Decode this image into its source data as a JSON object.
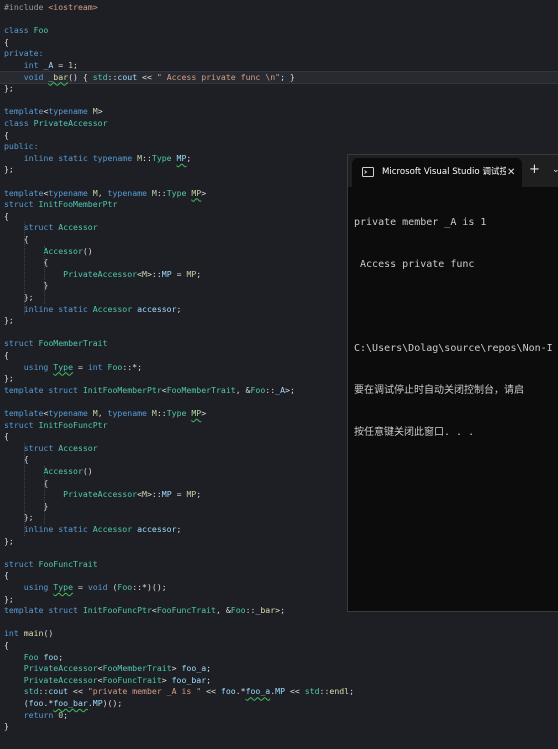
{
  "colors": {
    "editor_bg": "#1e1f24",
    "keyword": "#569cd6",
    "type": "#4ec9b0",
    "identifier": "#9cdcfe",
    "string": "#d69d85",
    "number": "#b5cea8",
    "preprocessor": "#9b9b9b",
    "template_param": "#b8d7a3",
    "plain": "#dcdcdc",
    "console_bg": "#0c0c0c",
    "console_text": "#cccccc"
  },
  "editor": {
    "lines": [
      [
        {
          "t": "#include ",
          "c": "pre"
        },
        {
          "t": "<iostream>",
          "c": "str"
        }
      ],
      [],
      [
        {
          "t": "class ",
          "c": "kw"
        },
        {
          "t": "Foo",
          "c": "ty"
        }
      ],
      [
        {
          "t": "{",
          "c": "pl"
        }
      ],
      [
        {
          "t": "private:",
          "c": "kw"
        }
      ],
      [
        {
          "t": "    ",
          "c": "pl"
        },
        {
          "t": "int ",
          "c": "kw"
        },
        {
          "t": "_A",
          "c": "id",
          "sq": true
        },
        {
          "t": " = ",
          "c": "pl"
        },
        {
          "t": "1",
          "c": "num"
        },
        {
          "t": ";",
          "c": "pl"
        }
      ],
      [
        {
          "t": "    ",
          "c": "pl"
        },
        {
          "t": "void ",
          "c": "kw"
        },
        {
          "t": "_bar",
          "c": "fn",
          "sq": true
        },
        {
          "t": "() { ",
          "c": "pl"
        },
        {
          "t": "std",
          "c": "ty"
        },
        {
          "t": "::",
          "c": "pl"
        },
        {
          "t": "cout",
          "c": "id"
        },
        {
          "t": " << ",
          "c": "pl"
        },
        {
          "t": "\" Access private func \\n\"",
          "c": "str"
        },
        {
          "t": "; }",
          "c": "pl"
        }
      ],
      [
        {
          "t": "};",
          "c": "pl"
        }
      ],
      [],
      [
        {
          "t": "template",
          "c": "kw"
        },
        {
          "t": "<",
          "c": "pl"
        },
        {
          "t": "typename ",
          "c": "kw"
        },
        {
          "t": "M",
          "c": "tp"
        },
        {
          "t": ">",
          "c": "pl"
        }
      ],
      [
        {
          "t": "class ",
          "c": "kw"
        },
        {
          "t": "PrivateAccessor",
          "c": "ty"
        }
      ],
      [
        {
          "t": "{",
          "c": "pl"
        }
      ],
      [
        {
          "t": "public:",
          "c": "kw"
        }
      ],
      [
        {
          "t": "    ",
          "c": "pl"
        },
        {
          "t": "inline static typename ",
          "c": "kw"
        },
        {
          "t": "M",
          "c": "tp"
        },
        {
          "t": "::",
          "c": "pl"
        },
        {
          "t": "Type ",
          "c": "ty"
        },
        {
          "t": "MP",
          "c": "id",
          "sq": true
        },
        {
          "t": ";",
          "c": "pl"
        }
      ],
      [
        {
          "t": "};",
          "c": "pl"
        }
      ],
      [],
      [
        {
          "t": "template",
          "c": "kw"
        },
        {
          "t": "<",
          "c": "pl"
        },
        {
          "t": "typename ",
          "c": "kw"
        },
        {
          "t": "M",
          "c": "tp"
        },
        {
          "t": ", ",
          "c": "pl"
        },
        {
          "t": "typename ",
          "c": "kw"
        },
        {
          "t": "M",
          "c": "tp"
        },
        {
          "t": "::",
          "c": "pl"
        },
        {
          "t": "Type ",
          "c": "ty"
        },
        {
          "t": "MP",
          "c": "tp",
          "sq": true
        },
        {
          "t": ">",
          "c": "pl"
        }
      ],
      [
        {
          "t": "struct ",
          "c": "kw"
        },
        {
          "t": "InitFooMemberPtr",
          "c": "ty"
        }
      ],
      [
        {
          "t": "{",
          "c": "pl"
        }
      ],
      [
        {
          "t": "    ",
          "c": "pl"
        },
        {
          "t": "struct ",
          "c": "kw"
        },
        {
          "t": "Accessor",
          "c": "ty"
        }
      ],
      [
        {
          "t": "    {",
          "c": "pl"
        }
      ],
      [
        {
          "t": "        ",
          "c": "pl"
        },
        {
          "t": "Accessor",
          "c": "ty"
        },
        {
          "t": "()",
          "c": "pl"
        }
      ],
      [
        {
          "t": "        {",
          "c": "pl"
        }
      ],
      [
        {
          "t": "            ",
          "c": "pl"
        },
        {
          "t": "PrivateAccessor",
          "c": "ty"
        },
        {
          "t": "<",
          "c": "pl"
        },
        {
          "t": "M",
          "c": "tp"
        },
        {
          "t": ">::",
          "c": "pl"
        },
        {
          "t": "MP",
          "c": "id"
        },
        {
          "t": " = ",
          "c": "pl"
        },
        {
          "t": "MP",
          "c": "tp"
        },
        {
          "t": ";",
          "c": "pl"
        }
      ],
      [
        {
          "t": "        }",
          "c": "pl"
        }
      ],
      [
        {
          "t": "    };",
          "c": "pl"
        }
      ],
      [
        {
          "t": "    ",
          "c": "pl"
        },
        {
          "t": "inline static ",
          "c": "kw"
        },
        {
          "t": "Accessor ",
          "c": "ty"
        },
        {
          "t": "accessor",
          "c": "id"
        },
        {
          "t": ";",
          "c": "pl"
        }
      ],
      [
        {
          "t": "};",
          "c": "pl"
        }
      ],
      [],
      [
        {
          "t": "struct ",
          "c": "kw"
        },
        {
          "t": "FooMemberTrait",
          "c": "ty"
        }
      ],
      [
        {
          "t": "{",
          "c": "pl"
        }
      ],
      [
        {
          "t": "    ",
          "c": "pl"
        },
        {
          "t": "using ",
          "c": "kw"
        },
        {
          "t": "Type",
          "c": "ty",
          "sq": true
        },
        {
          "t": " = ",
          "c": "pl"
        },
        {
          "t": "int ",
          "c": "kw"
        },
        {
          "t": "Foo",
          "c": "ty"
        },
        {
          "t": "::*;",
          "c": "pl"
        }
      ],
      [
        {
          "t": "};",
          "c": "pl"
        }
      ],
      [
        {
          "t": "template struct ",
          "c": "kw"
        },
        {
          "t": "InitFooMemberPtr",
          "c": "ty"
        },
        {
          "t": "<",
          "c": "pl"
        },
        {
          "t": "FooMemberTrait",
          "c": "ty"
        },
        {
          "t": ", &",
          "c": "pl"
        },
        {
          "t": "Foo",
          "c": "ty"
        },
        {
          "t": "::",
          "c": "pl"
        },
        {
          "t": "_A",
          "c": "id"
        },
        {
          "t": ">;",
          "c": "pl"
        }
      ],
      [],
      [
        {
          "t": "template",
          "c": "kw"
        },
        {
          "t": "<",
          "c": "pl"
        },
        {
          "t": "typename ",
          "c": "kw"
        },
        {
          "t": "M",
          "c": "tp"
        },
        {
          "t": ", ",
          "c": "pl"
        },
        {
          "t": "typename ",
          "c": "kw"
        },
        {
          "t": "M",
          "c": "tp"
        },
        {
          "t": "::",
          "c": "pl"
        },
        {
          "t": "Type ",
          "c": "ty"
        },
        {
          "t": "MP",
          "c": "tp",
          "sq": true
        },
        {
          "t": ">",
          "c": "pl"
        }
      ],
      [
        {
          "t": "struct ",
          "c": "kw"
        },
        {
          "t": "InitFooFuncPtr",
          "c": "ty"
        }
      ],
      [
        {
          "t": "{",
          "c": "pl"
        }
      ],
      [
        {
          "t": "    ",
          "c": "pl"
        },
        {
          "t": "struct ",
          "c": "kw"
        },
        {
          "t": "Accessor",
          "c": "ty"
        }
      ],
      [
        {
          "t": "    {",
          "c": "pl"
        }
      ],
      [
        {
          "t": "        ",
          "c": "pl"
        },
        {
          "t": "Accessor",
          "c": "ty"
        },
        {
          "t": "()",
          "c": "pl"
        }
      ],
      [
        {
          "t": "        {",
          "c": "pl"
        }
      ],
      [
        {
          "t": "            ",
          "c": "pl"
        },
        {
          "t": "PrivateAccessor",
          "c": "ty"
        },
        {
          "t": "<",
          "c": "pl"
        },
        {
          "t": "M",
          "c": "tp"
        },
        {
          "t": ">::",
          "c": "pl"
        },
        {
          "t": "MP",
          "c": "id"
        },
        {
          "t": " = ",
          "c": "pl"
        },
        {
          "t": "MP",
          "c": "tp"
        },
        {
          "t": ";",
          "c": "pl"
        }
      ],
      [
        {
          "t": "        }",
          "c": "pl"
        }
      ],
      [
        {
          "t": "    };",
          "c": "pl"
        }
      ],
      [
        {
          "t": "    ",
          "c": "pl"
        },
        {
          "t": "inline static ",
          "c": "kw"
        },
        {
          "t": "Accessor ",
          "c": "ty"
        },
        {
          "t": "accessor",
          "c": "id"
        },
        {
          "t": ";",
          "c": "pl"
        }
      ],
      [
        {
          "t": "};",
          "c": "pl"
        }
      ],
      [],
      [
        {
          "t": "struct ",
          "c": "kw"
        },
        {
          "t": "FooFuncTrait",
          "c": "ty"
        }
      ],
      [
        {
          "t": "{",
          "c": "pl"
        }
      ],
      [
        {
          "t": "    ",
          "c": "pl"
        },
        {
          "t": "using ",
          "c": "kw"
        },
        {
          "t": "Type",
          "c": "ty",
          "sq": true
        },
        {
          "t": " = ",
          "c": "pl"
        },
        {
          "t": "void ",
          "c": "kw"
        },
        {
          "t": "(",
          "c": "pl"
        },
        {
          "t": "Foo",
          "c": "ty"
        },
        {
          "t": "::*)();",
          "c": "pl"
        }
      ],
      [
        {
          "t": "};",
          "c": "pl"
        }
      ],
      [
        {
          "t": "template struct ",
          "c": "kw"
        },
        {
          "t": "InitFooFuncPtr",
          "c": "ty"
        },
        {
          "t": "<",
          "c": "pl"
        },
        {
          "t": "FooFuncTrait",
          "c": "ty"
        },
        {
          "t": ", &",
          "c": "pl"
        },
        {
          "t": "Foo",
          "c": "ty"
        },
        {
          "t": "::",
          "c": "pl"
        },
        {
          "t": "_bar",
          "c": "fn"
        },
        {
          "t": ">;",
          "c": "pl"
        }
      ],
      [],
      [
        {
          "t": "int ",
          "c": "kw"
        },
        {
          "t": "main",
          "c": "fn"
        },
        {
          "t": "()",
          "c": "pl"
        }
      ],
      [
        {
          "t": "{",
          "c": "pl"
        }
      ],
      [
        {
          "t": "    ",
          "c": "pl"
        },
        {
          "t": "Foo ",
          "c": "ty"
        },
        {
          "t": "foo",
          "c": "id"
        },
        {
          "t": ";",
          "c": "pl"
        }
      ],
      [
        {
          "t": "    ",
          "c": "pl"
        },
        {
          "t": "PrivateAccessor",
          "c": "ty"
        },
        {
          "t": "<",
          "c": "pl"
        },
        {
          "t": "FooMemberTrait",
          "c": "ty"
        },
        {
          "t": "> ",
          "c": "pl"
        },
        {
          "t": "foo_a",
          "c": "id"
        },
        {
          "t": ";",
          "c": "pl"
        }
      ],
      [
        {
          "t": "    ",
          "c": "pl"
        },
        {
          "t": "PrivateAccessor",
          "c": "ty"
        },
        {
          "t": "<",
          "c": "pl"
        },
        {
          "t": "FooFuncTrait",
          "c": "ty"
        },
        {
          "t": "> ",
          "c": "pl"
        },
        {
          "t": "foo_bar",
          "c": "id"
        },
        {
          "t": ";",
          "c": "pl"
        }
      ],
      [
        {
          "t": "    ",
          "c": "pl"
        },
        {
          "t": "std",
          "c": "ty"
        },
        {
          "t": "::",
          "c": "pl"
        },
        {
          "t": "cout",
          "c": "id"
        },
        {
          "t": " << ",
          "c": "pl"
        },
        {
          "t": "\"private member _A is \"",
          "c": "str"
        },
        {
          "t": " << ",
          "c": "pl"
        },
        {
          "t": "foo",
          "c": "id"
        },
        {
          "t": ".*",
          "c": "pl"
        },
        {
          "t": "foo_a",
          "c": "id",
          "sq": true
        },
        {
          "t": ".",
          "c": "pl"
        },
        {
          "t": "MP",
          "c": "id"
        },
        {
          "t": " << ",
          "c": "pl"
        },
        {
          "t": "std",
          "c": "ty"
        },
        {
          "t": "::",
          "c": "pl"
        },
        {
          "t": "endl",
          "c": "fn"
        },
        {
          "t": ";",
          "c": "pl"
        }
      ],
      [
        {
          "t": "    (",
          "c": "pl"
        },
        {
          "t": "foo",
          "c": "id"
        },
        {
          "t": ".*",
          "c": "pl"
        },
        {
          "t": "foo_bar",
          "c": "id",
          "sq": true
        },
        {
          "t": ".",
          "c": "pl"
        },
        {
          "t": "MP",
          "c": "id"
        },
        {
          "t": ")();",
          "c": "pl"
        }
      ],
      [
        {
          "t": "    ",
          "c": "pl"
        },
        {
          "t": "return ",
          "c": "kw"
        },
        {
          "t": "0",
          "c": "num"
        },
        {
          "t": ";",
          "c": "pl"
        }
      ],
      [
        {
          "t": "}",
          "c": "pl"
        }
      ]
    ],
    "cursor_line": 6
  },
  "console": {
    "title": "Microsoft Visual Studio 调试控制台",
    "icon": "terminal-icon",
    "close_label": "✕",
    "new_tab_label": "+",
    "dropdown_label": "⌄",
    "output_lines": [
      "private member _A is 1",
      " Access private func",
      "",
      "C:\\Users\\Dolag\\source\\repos\\Non-I",
      "要在调试停止时自动关闭控制台，请启",
      "按任意键关闭此窗口. . ."
    ]
  }
}
